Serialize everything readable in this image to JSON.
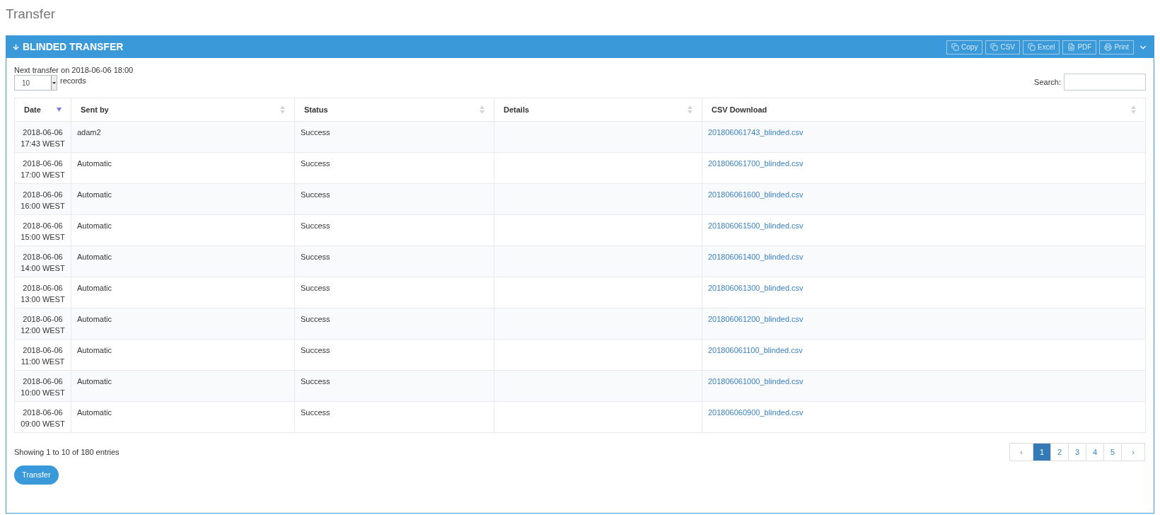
{
  "page_title": "Transfer",
  "panel": {
    "title": "BLINDED TRANSFER",
    "toolbar": [
      {
        "label": "Copy",
        "kind": "copy"
      },
      {
        "label": "CSV",
        "kind": "copy"
      },
      {
        "label": "Excel",
        "kind": "copy"
      },
      {
        "label": "PDF",
        "kind": "file"
      },
      {
        "label": "Print",
        "kind": "print"
      }
    ]
  },
  "next_transfer": {
    "label": "Next transfer on",
    "value": "2018-06-06 18:00"
  },
  "length": {
    "value": "10",
    "label": "records"
  },
  "search": {
    "label": "Search:"
  },
  "table": {
    "columns": [
      {
        "label": "Date",
        "sorted": true
      },
      {
        "label": "Sent by",
        "sorted": false
      },
      {
        "label": "Status",
        "sorted": false
      },
      {
        "label": "Details",
        "sorted": false
      },
      {
        "label": "CSV Download",
        "sorted": false
      }
    ],
    "rows": [
      {
        "date": "2018-06-06",
        "time": "17:43 WEST",
        "sent_by": "adam2",
        "status": "Success",
        "file": "201806061743_blinded.csv"
      },
      {
        "date": "2018-06-06",
        "time": "17:00 WEST",
        "sent_by": "Automatic",
        "status": "Success",
        "file": "201806061700_blinded.csv"
      },
      {
        "date": "2018-06-06",
        "time": "16:00 WEST",
        "sent_by": "Automatic",
        "status": "Success",
        "file": "201806061600_blinded.csv"
      },
      {
        "date": "2018-06-06",
        "time": "15:00 WEST",
        "sent_by": "Automatic",
        "status": "Success",
        "file": "201806061500_blinded.csv"
      },
      {
        "date": "2018-06-06",
        "time": "14:00 WEST",
        "sent_by": "Automatic",
        "status": "Success",
        "file": "201806061400_blinded.csv"
      },
      {
        "date": "2018-06-06",
        "time": "13:00 WEST",
        "sent_by": "Automatic",
        "status": "Success",
        "file": "201806061300_blinded.csv"
      },
      {
        "date": "2018-06-06",
        "time": "12:00 WEST",
        "sent_by": "Automatic",
        "status": "Success",
        "file": "201806061200_blinded.csv"
      },
      {
        "date": "2018-06-06",
        "time": "11:00 WEST",
        "sent_by": "Automatic",
        "status": "Success",
        "file": "201806061100_blinded.csv"
      },
      {
        "date": "2018-06-06",
        "time": "10:00 WEST",
        "sent_by": "Automatic",
        "status": "Success",
        "file": "201806061000_blinded.csv"
      },
      {
        "date": "2018-06-06",
        "time": "09:00 WEST",
        "sent_by": "Automatic",
        "status": "Success",
        "file": "201806060900_blinded.csv"
      }
    ]
  },
  "info": "Showing 1 to 10 of 180 entries",
  "pagination": [
    {
      "label": "‹",
      "selected": false
    },
    {
      "label": "1",
      "selected": true
    },
    {
      "label": "2",
      "selected": false
    },
    {
      "label": "3",
      "selected": false
    },
    {
      "label": "4",
      "selected": false
    },
    {
      "label": "5",
      "selected": false
    },
    {
      "label": "›",
      "selected": false
    }
  ],
  "transfer_button": "Transfer"
}
